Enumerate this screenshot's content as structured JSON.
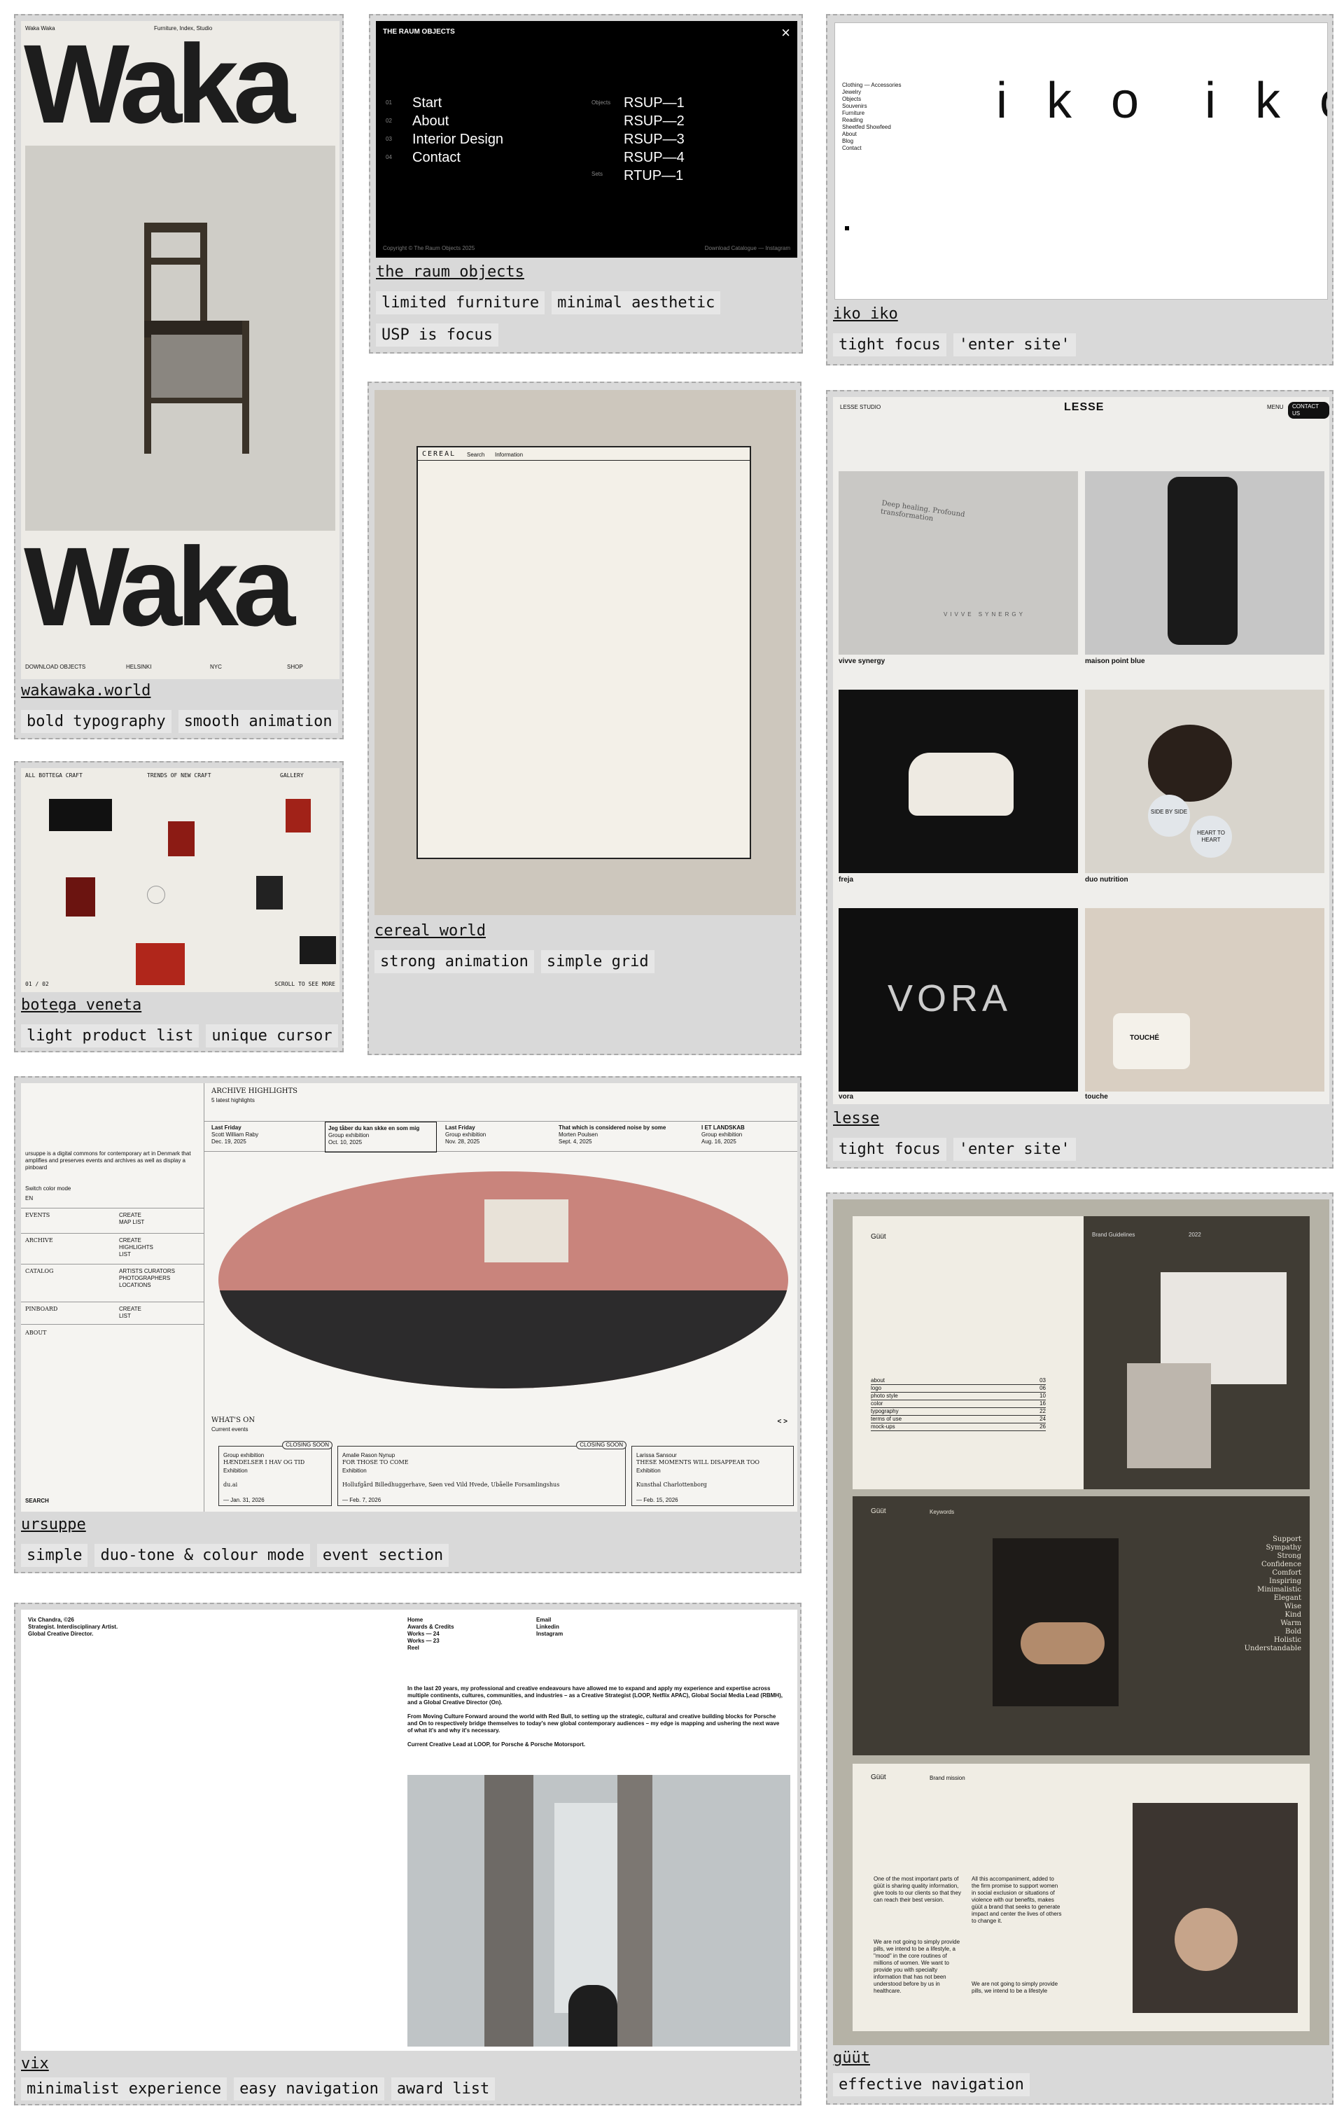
{
  "cards": {
    "waka": {
      "title": "wakawaka.world",
      "tags": [
        "bold typography",
        "smooth animation"
      ],
      "shot": {
        "brand_word": "Waka",
        "top_left": "Waka Waka",
        "top_center": "Furniture, Index, Studio",
        "bottom": [
          "DOWNLOAD OBJECTS",
          "HELSINKI",
          "NYC",
          "SHOP"
        ]
      }
    },
    "raum": {
      "title": "the raum objects",
      "tags": [
        "limited furniture",
        "minimal aesthetic",
        "USP is focus"
      ],
      "shot": {
        "heading": "THE RAUM OBJECTS",
        "close": "×",
        "nav": [
          "Start",
          "About",
          "Interior Design",
          "Contact"
        ],
        "nums": [
          "01",
          "02",
          "03",
          "04"
        ],
        "side_a": "Objects",
        "side_b": "Sets",
        "items": [
          "RSUP—1",
          "RSUP—2",
          "RSUP—3",
          "RSUP—4",
          "RTUP—1"
        ],
        "footer_left": "Copyright © The Raum Objects 2025",
        "footer_right": "Download Catalogue — Instagram"
      }
    },
    "iko": {
      "title": "iko iko",
      "tags": [
        "tight focus",
        "'enter site'"
      ],
      "shot": {
        "logo": "i k o  i k o",
        "menu": [
          "Clothing — Accessories",
          "Jewelry",
          "Objects",
          "Souvenirs",
          "Furniture",
          "Reading",
          "Sheetfed Showfeed",
          "About",
          "Blog",
          "Contact"
        ]
      }
    },
    "botega": {
      "title": "botega veneta",
      "tags": [
        "light product list",
        "unique cursor"
      ],
      "shot": {
        "top_left": "ALL BOTTEGA CRAFT",
        "top_center": "TRENDS OF NEW CRAFT",
        "top_right": "GALLERY",
        "bottom_left": "01 / 02",
        "bottom_right": "SCROLL TO SEE MORE"
      }
    },
    "cereal": {
      "title": "cereal world",
      "tags": [
        "strong animation",
        "simple grid"
      ],
      "shot": {
        "logo": "CEREAL",
        "nav_a": "Search",
        "nav_b": "Information"
      }
    },
    "lesse": {
      "title": "lesse",
      "tags": [
        "tight focus",
        "'enter site'"
      ],
      "shot": {
        "logo": "LESSE",
        "top_left": "LESSE STUDIO",
        "menu": "MENU",
        "contact": "CONTACT US",
        "items": [
          "vivve synergy",
          "maison point blue",
          "freja",
          "duo nutrition",
          "vora",
          "touche"
        ],
        "box_text": "Deep healing. Profound transformation",
        "box_brand": "VIVVE SYNERGY",
        "vora_logo": "VORA",
        "touche_label": "TOUCHÉ",
        "badge_a": "SIDE BY SIDE",
        "badge_b": "HEART TO HEART"
      }
    },
    "ursuppe": {
      "title": "ursuppe",
      "tags": [
        "simple",
        "duo-tone & colour mode",
        "event section"
      ],
      "shot": {
        "intro": "ursuppe is a digital commons for contemporary art in Denmark that amplifies and preserves events and archives as well as display a pinboard",
        "switch": "Switch color mode",
        "lang": "EN",
        "menu": [
          {
            "label": "EVENTS",
            "sub": "CREATE MAP LIST"
          },
          {
            "label": "ARCHIVE",
            "sub": "CREATE HIGHLIGHTS LIST"
          },
          {
            "label": "CATALOG",
            "sub": "ARTISTS CURATORS PHOTOGRAPHERS LOCATIONS"
          },
          {
            "label": "PINBOARD",
            "sub": "CREATE LIST"
          },
          {
            "label": "ABOUT",
            "sub": ""
          }
        ],
        "search": "SEARCH",
        "archive_title": "ARCHIVE HIGHLIGHTS",
        "archive_sub": "5 latest highlights",
        "highlights": [
          {
            "t": "Last Friday",
            "a": "Scott William Raby",
            "d": "Dec. 19, 2025"
          },
          {
            "t": "Jeg tåber du kan skke en som mig",
            "a": "Group exhibition",
            "d": "Oct. 10, 2025"
          },
          {
            "t": "Last Friday",
            "a": "Group exhibition",
            "d": "Nov. 28, 2025"
          },
          {
            "t": "That which is considered noise by some",
            "a": "Morten Poulsen",
            "d": "Sept. 4, 2025"
          },
          {
            "t": "I ET LANDSKAB",
            "a": "Group exhibition",
            "d": "Aug. 16, 2025"
          }
        ],
        "whats_on": "WHAT'S ON",
        "whats_sub": "Current events",
        "arrows": "< >",
        "events": [
          {
            "badge": "CLOSING SOON",
            "kind": "Group exhibition",
            "title": "HÆNDELSER I HAV OG TID",
            "type": "Exhibition",
            "place": "du.ai",
            "date": "— Jan. 31, 2026"
          },
          {
            "badge": "CLOSING SOON",
            "kind": "Amalie Rason Nynup",
            "title": "FOR THOSE TO COME",
            "type": "Exhibition",
            "place": "Hollufgård Billedhuggerhave, Søen ved Vild Hvede, Ubåelle Forsamlingshus",
            "date": "— Feb. 7, 2026"
          },
          {
            "badge": "",
            "kind": "Larissa Sansour",
            "title": "THESE MOMENTS WILL DISAPPEAR TOO",
            "type": "Exhibition",
            "place": "Kunsthal Charlottenborg",
            "date": "— Feb. 15, 2026"
          }
        ]
      }
    },
    "vix": {
      "title": "vix",
      "tags": [
        "minimalist experience",
        "easy navigation",
        "award list"
      ],
      "shot": {
        "name": "Vix Chandra, ©26",
        "role_a": "Strategist. Interdisciplinary Artist.",
        "role_b": "Global Creative Director.",
        "nav": [
          "Home",
          "Awards & Credits",
          "Works — 24",
          "Works — 23",
          "Reel"
        ],
        "links": [
          "Email",
          "Linkedin",
          "Instagram"
        ],
        "bio_a": "In the last 20 years, my professional and creative endeavours have allowed me to expand and apply my experience and expertise across multiple continents, cultures, communities, and industries – as a Creative Strategist (LOOP, Netflix APAC), Global Social Media Lead (RBMH), and a Global Creative Director (On).",
        "bio_b": "From Moving Culture Forward around the world with Red Bull, to setting up the strategic, cultural and creative building blocks for Porsche and On to respectively bridge themselves to today's new global contemporary audiences – my edge is mapping and ushering the next wave of what it's and why it's necessary.",
        "bio_c": "Current Creative Lead at LOOP, for Porsche & Porsche Motorsport."
      }
    },
    "guut": {
      "title": "güüt",
      "tags": [
        "effective navigation"
      ],
      "shot": {
        "logo": "Güüt",
        "guide": "Brand Guidelines",
        "year": "2022",
        "toc": [
          [
            "about",
            "03"
          ],
          [
            "logo",
            "06"
          ],
          [
            "photo style",
            "10"
          ],
          [
            "color",
            "16"
          ],
          [
            "typography",
            "22"
          ],
          [
            "terms of use",
            "24"
          ],
          [
            "mock-ups",
            "26"
          ]
        ],
        "keywords_label": "Keywords",
        "keywords": [
          "Support",
          "Sympathy",
          "Strong",
          "Confidence",
          "Comfort",
          "Inspiring",
          "Minimalistic",
          "Elegant",
          "Wise",
          "Kind",
          "Warm",
          "Bold",
          "Holistic",
          "Understandable"
        ],
        "mission_label": "Brand mission",
        "mission_a": "One of the most important parts of güüt is sharing quality information, give tools to our clients so that they can reach their best version.",
        "mission_b": "We are not going to simply provide pills, we intend to be a lifestyle, a \"mood\" in the core routines of millions of women. We want to provide you with specialty information that has not been understood before by us in healthcare.",
        "mission_c": "All this accompaniment, added to the firm promise to support women in social exclusion or situations of violence with our benefits, makes güüt a brand that seeks to generate impact and center the lives of others to change it.",
        "mission_d": "We are not going to simply provide pills, we intend to be a lifestyle"
      }
    }
  },
  "colors": {
    "card_bg": "#d9d9d9",
    "tag_bg": "#e6e6e6",
    "raum_bg": "#000000",
    "cream": "#f0ede4",
    "dark_olive": "#403c34",
    "guut_bg": "#b5b2a6"
  }
}
